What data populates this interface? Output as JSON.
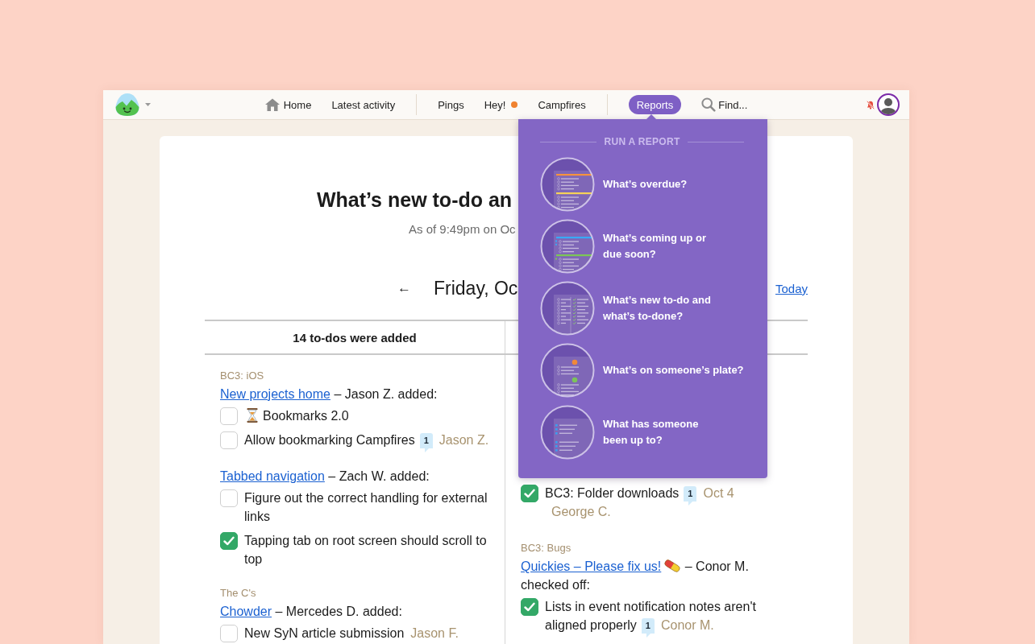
{
  "nav": {
    "groups": [
      {
        "items": [
          {
            "kind": "home",
            "label": "Home",
            "selected": false,
            "unread": false
          },
          {
            "kind": "link",
            "label": "Latest activity",
            "selected": false,
            "unread": false
          }
        ]
      },
      {
        "items": [
          {
            "kind": "link",
            "label": "Pings",
            "selected": false,
            "unread": false
          },
          {
            "kind": "link",
            "label": "Hey!",
            "selected": false,
            "unread": true
          },
          {
            "kind": "link",
            "label": "Campfires",
            "selected": false,
            "unread": false
          }
        ]
      },
      {
        "items": [
          {
            "kind": "link",
            "label": "Reports",
            "selected": true,
            "unread": false
          },
          {
            "kind": "search",
            "label": "Find...",
            "selected": false,
            "unread": false
          }
        ]
      }
    ],
    "notifications_off": true
  },
  "report_menu": {
    "heading": "RUN A REPORT",
    "items": [
      {
        "kind": "overdue",
        "lines": [
          "What’s overdue?"
        ]
      },
      {
        "kind": "upcoming",
        "lines": [
          "What’s coming up or",
          "due soon?"
        ]
      },
      {
        "kind": "todone",
        "lines": [
          "What’s new to-do and",
          "what’s to-done?"
        ]
      },
      {
        "kind": "assignments",
        "lines": [
          "What’s on someone’s plate?"
        ]
      },
      {
        "kind": "activity",
        "lines": [
          "What has someone",
          "been up to?"
        ]
      }
    ]
  },
  "report": {
    "title": "What’s new to-do an",
    "subtitle": "As of 9:49pm on Oc",
    "previous": "←",
    "date": "Friday, Oc",
    "today": "Today",
    "columns": [
      {
        "heading": "14 to-dos were added",
        "groups": [
          {
            "project": "BC3: iOS",
            "kind": "plain",
            "list": "New projects home",
            "action": "– Jason Z. added:",
            "todos": [
              {
                "kind": "hourglass",
                "text": "Bookmarks 2.0",
                "checked": false
              },
              {
                "kind": "plain",
                "text": "Allow bookmarking Campfires",
                "checked": false,
                "comments": "1",
                "person": "Jason Z."
              }
            ]
          },
          {
            "kind": "plain",
            "list": "Tabbed navigation",
            "action": "– Zach W. added:",
            "todos": [
              {
                "kind": "plain",
                "text": "Figure out the correct handling for external links",
                "checked": false
              },
              {
                "kind": "plain",
                "text": "Tapping tab on root screen should scroll to top",
                "checked": true
              }
            ]
          },
          {
            "project": "The C's",
            "kind": "plain",
            "list": "Chowder",
            "action": "– Mercedes D. added:",
            "todos": [
              {
                "kind": "plain",
                "text": "New SyN article submission",
                "checked": false,
                "person": "Jason F."
              }
            ]
          }
        ]
      },
      {
        "groups": [
          {
            "todos": [
              {
                "kind": "plain",
                "text": "BC3: Folder downloads",
                "checked": true,
                "comments": "1",
                "due": "Oct 4",
                "person": "George C."
              }
            ]
          },
          {
            "project": "BC3: Bugs",
            "kind": "pill",
            "list": "Quickies – Please fix us!",
            "action": "– Conor M. checked off:",
            "todos": [
              {
                "kind": "plain",
                "text": "Lists in event notification notes aren't aligned properly",
                "checked": true,
                "comments": "1",
                "person": "Conor M."
              }
            ]
          }
        ]
      }
    ]
  }
}
